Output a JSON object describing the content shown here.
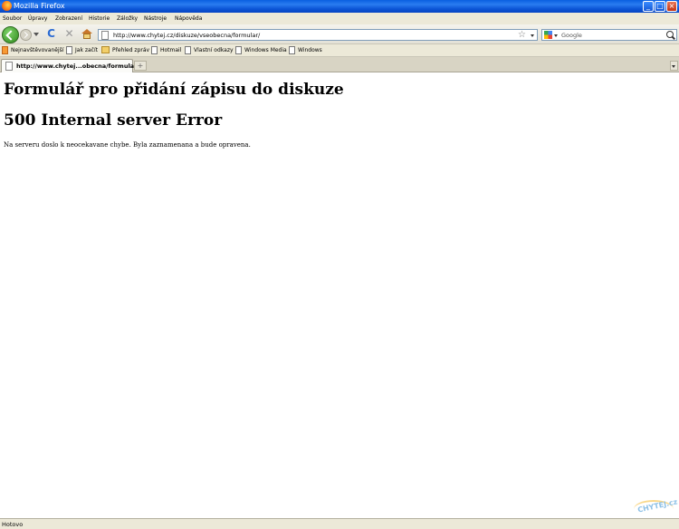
{
  "window": {
    "title": "Mozilla Firefox",
    "controls": {
      "minimize": "_",
      "maximize": "□",
      "close": "×"
    }
  },
  "menu": {
    "items": [
      "Soubor",
      "Úpravy",
      "Zobrazení",
      "Historie",
      "Záložky",
      "Nástroje",
      "Nápověda"
    ]
  },
  "navigation": {
    "url": "http://www.chytej.cz/diskuze/vseobecna/formular/",
    "search_placeholder": "Google",
    "reload_glyph": "C",
    "stop_glyph": "✕",
    "star_glyph": "☆"
  },
  "bookmarks": {
    "items": [
      {
        "label": "Nejnavštěvovanější",
        "icon": "bookmark-icon"
      },
      {
        "label": "Jak začít",
        "icon": "page-icon"
      },
      {
        "label": "Přehled zpráv",
        "icon": "feed-icon"
      },
      {
        "label": "Hotmail",
        "icon": "page-icon"
      },
      {
        "label": "Vlastní odkazy",
        "icon": "page-icon"
      },
      {
        "label": "Windows Media",
        "icon": "page-icon"
      },
      {
        "label": "Windows",
        "icon": "page-icon"
      }
    ]
  },
  "tabs": {
    "active_label": "http://www.chytej...obecna/formular/",
    "new_tab_glyph": "+"
  },
  "page": {
    "heading": "Formulář pro přidání zápisu do diskuze",
    "error_heading": "500 Internal server Error",
    "message": "Na serveru doslo k neocekavane chybe. Byla zaznamenana a bude opravena."
  },
  "watermark": {
    "text": "CHYTEJ.cz"
  },
  "status": {
    "text": "Hotovo"
  }
}
